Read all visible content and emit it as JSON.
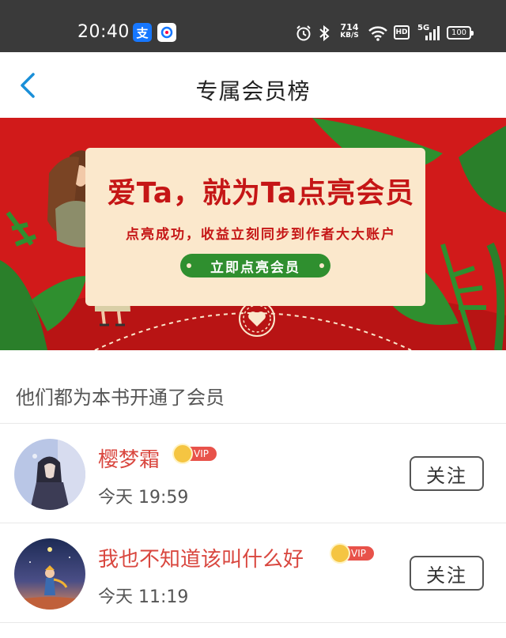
{
  "status_bar": {
    "time": "20:40",
    "alipay_icon": "支",
    "speed_value": "714",
    "speed_unit": "KB/S",
    "hd_label": "HD",
    "network_label": "5G",
    "battery_level": "100"
  },
  "header": {
    "title": "专属会员榜"
  },
  "banner": {
    "headline": "爱Ta，就为Ta点亮会员",
    "subline": "点亮成功，收益立刻同步到作者大大账户",
    "button_label": "立即点亮会员",
    "colors": {
      "background": "#d11a1a",
      "card": "#fbe8cc",
      "button": "#2f8f2f",
      "text": "#c51616"
    }
  },
  "section": {
    "title": "他们都为本书开通了会员"
  },
  "members": [
    {
      "name": "樱梦霜",
      "badge": "VIP",
      "time": "今天 19:59",
      "follow_label": "关注"
    },
    {
      "name": "我也不知道该叫什么好",
      "badge": "VIP",
      "time": "今天 11:19",
      "follow_label": "关注"
    }
  ],
  "colors": {
    "name_color": "#d9473f",
    "accent_blue": "#1a8fd8"
  }
}
